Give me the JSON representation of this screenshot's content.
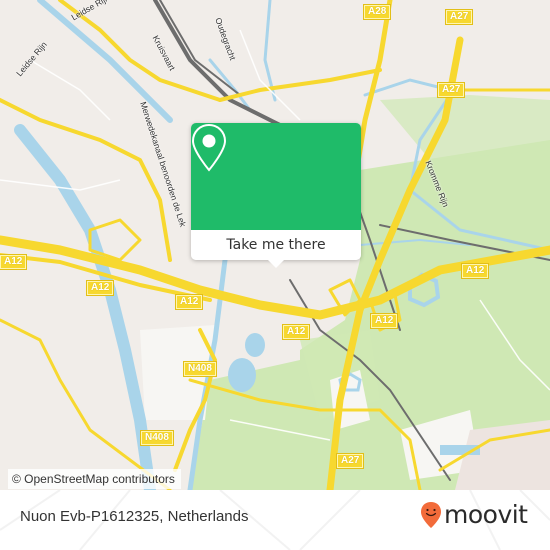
{
  "map": {
    "colors": {
      "land": "#f1ede9",
      "green": "#cfe8b4",
      "water": "#a9d4ea",
      "motorway": "#f7d82f",
      "rail": "#6d6d6d"
    },
    "road_labels": [
      {
        "id": "a28",
        "text": "A28"
      },
      {
        "id": "a27-top",
        "text": "A27"
      },
      {
        "id": "a27-mid",
        "text": "A27"
      },
      {
        "id": "a27-bottom",
        "text": "A27"
      },
      {
        "id": "a12-west",
        "text": "A12"
      },
      {
        "id": "a12-center-left",
        "text": "A12"
      },
      {
        "id": "a12-center",
        "text": "A12"
      },
      {
        "id": "a12-east-1",
        "text": "A12"
      },
      {
        "id": "a12-east-2",
        "text": "A12"
      },
      {
        "id": "n408-north",
        "text": "N408"
      },
      {
        "id": "n408-south",
        "text": "N408"
      }
    ],
    "street_labels": [
      {
        "id": "leidse-rijn-1",
        "text": "Leidse Rijn"
      },
      {
        "id": "leidse-rijn-2",
        "text": "Leidse Rijn"
      },
      {
        "id": "kruisvaart",
        "text": "Kruisvaart"
      },
      {
        "id": "oudegracht",
        "text": "Oudegracht"
      },
      {
        "id": "merwedekanaal",
        "text": "Merwedekanaal benoorden de Lek"
      },
      {
        "id": "kromme-rijn",
        "text": "Kromme Rijn"
      }
    ]
  },
  "popup": {
    "icon": "map-pin-icon",
    "button_label": "Take me there"
  },
  "attribution": "© OpenStreetMap contributors",
  "footer": {
    "place_name": "Nuon Evb-P1612325, Netherlands",
    "brand": {
      "name": "moovit",
      "icon": "moovit-pin-smile-icon",
      "accent": "#f26b3a"
    }
  }
}
